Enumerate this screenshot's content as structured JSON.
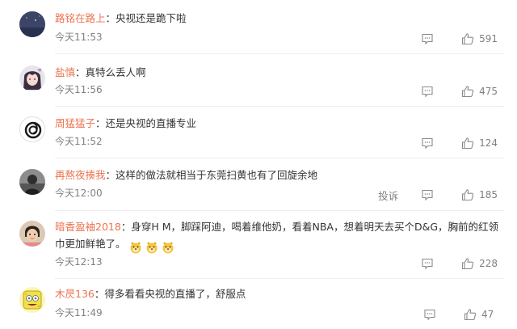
{
  "comments": [
    {
      "username": "路铭在路上",
      "separator": "：",
      "text": "央视还是跪下啦",
      "time": "今天11:53",
      "likes": "591",
      "avatar": "night-sky-avatar"
    },
    {
      "username": "盐慎",
      "separator": "：",
      "text": "真特么丢人啊",
      "time": "今天11:56",
      "likes": "475",
      "avatar": "anime-girl-avatar"
    },
    {
      "username": "周猛猛子",
      "separator": "：",
      "text": "还是央视的直播专业",
      "time": "今天11:52",
      "likes": "124",
      "avatar": "swirl-logo-avatar"
    },
    {
      "username": "再熬夜揍我",
      "separator": "：",
      "text": "这样的做法就相当于东莞扫黄也有了回旋余地",
      "time": "今天12:00",
      "likes": "185",
      "report": "投诉",
      "avatar": "dark-figure-avatar"
    },
    {
      "username": "暗香盈袖2018",
      "separator": "：",
      "text": "身穿H M，脚踩阿迪，喝着维他奶，看着NBA，想着明天去买个D&G，胸前的红领巾更加鲜艳了。",
      "time": "今天12:13",
      "likes": "228",
      "emojis": [
        "doge-emoji",
        "doge-emoji",
        "doge-emoji"
      ],
      "avatar": "child-photo-avatar"
    },
    {
      "username": "木昃136",
      "separator": "：",
      "text": "得多看看央视的直播了，舒服点",
      "time": "今天11:49",
      "likes": "47",
      "avatar": "sponge-cartoon-avatar"
    }
  ],
  "colors": {
    "username": "#eb7350",
    "time": "#808080",
    "text": "#333333",
    "divider": "#eeeeee"
  }
}
